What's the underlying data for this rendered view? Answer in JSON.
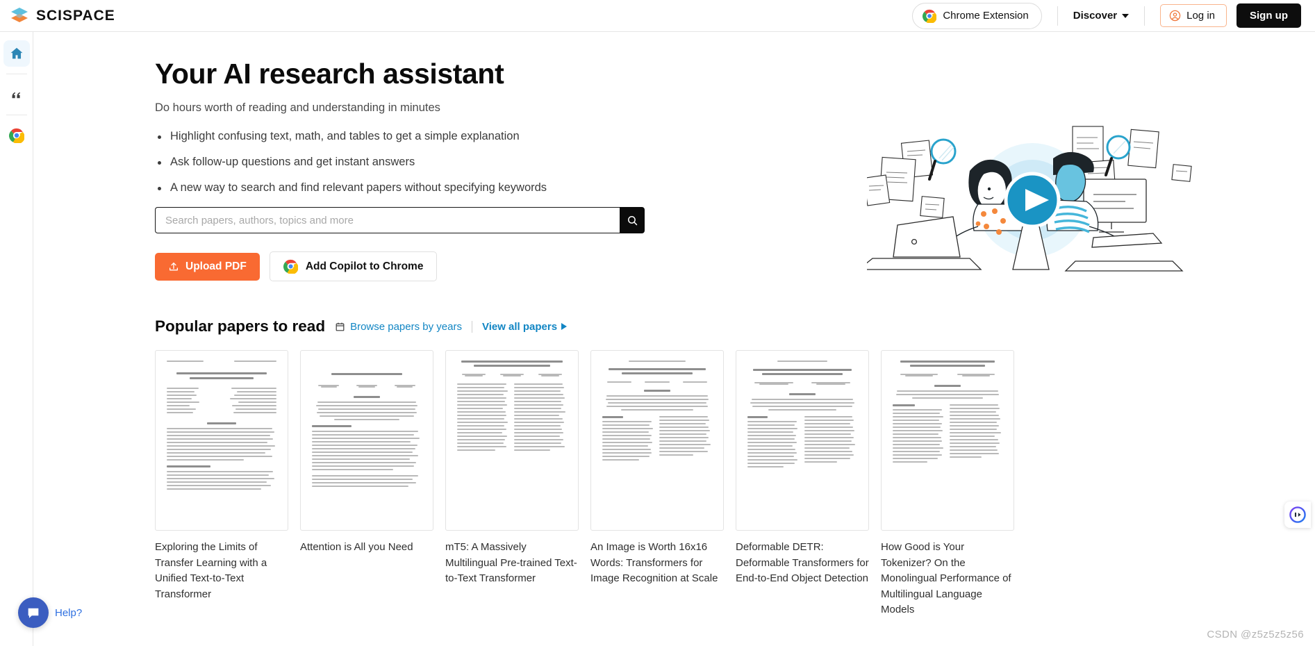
{
  "header": {
    "brand_name": "SCISPACE",
    "chrome_extension_label": "Chrome Extension",
    "discover_label": "Discover",
    "login_label": "Log in",
    "signup_label": "Sign up"
  },
  "sidebar": {
    "items": [
      {
        "icon": "home-icon",
        "active": true
      },
      {
        "icon": "quote-icon",
        "active": false
      },
      {
        "icon": "chrome-icon",
        "active": false
      }
    ]
  },
  "hero": {
    "title": "Your AI research assistant",
    "subtitle": "Do hours worth of reading and understanding in minutes",
    "bullets": [
      "Highlight confusing text, math, and tables to get a simple explanation",
      "Ask follow-up questions and get instant answers",
      "A new way to search and find relevant papers without specifying keywords"
    ],
    "search_placeholder": "Search papers, authors, topics and more",
    "search_value": "",
    "upload_label": "Upload PDF",
    "copilot_label": "Add Copilot to Chrome"
  },
  "papers": {
    "section_title": "Popular papers to read",
    "browse_label": "Browse papers by years",
    "view_all_label": "View all papers",
    "items": [
      {
        "title": "Exploring the Limits of Transfer Learning with a Unified Text-to-Text Transformer"
      },
      {
        "title": "Attention is All you Need"
      },
      {
        "title": "mT5: A Massively Multilingual Pre-trained Text-to-Text Transformer"
      },
      {
        "title": "An Image is Worth 16x16 Words: Transformers for Image Recognition at Scale"
      },
      {
        "title": "Deformable DETR: Deformable Transformers for End-to-End Object Detection"
      },
      {
        "title": "How Good is Your Tokenizer? On the Monolingual Performance of Multilingual Language Models"
      }
    ]
  },
  "help": {
    "label": "Help?"
  },
  "watermark": {
    "text": "CSDN @z5z5z5z56"
  },
  "colors": {
    "accent_orange": "#f96a32",
    "link_blue": "#1286c4",
    "sidebar_active_blue": "#2c86b5",
    "black": "#0b0b0b",
    "help_blue": "#3b5dc0"
  }
}
